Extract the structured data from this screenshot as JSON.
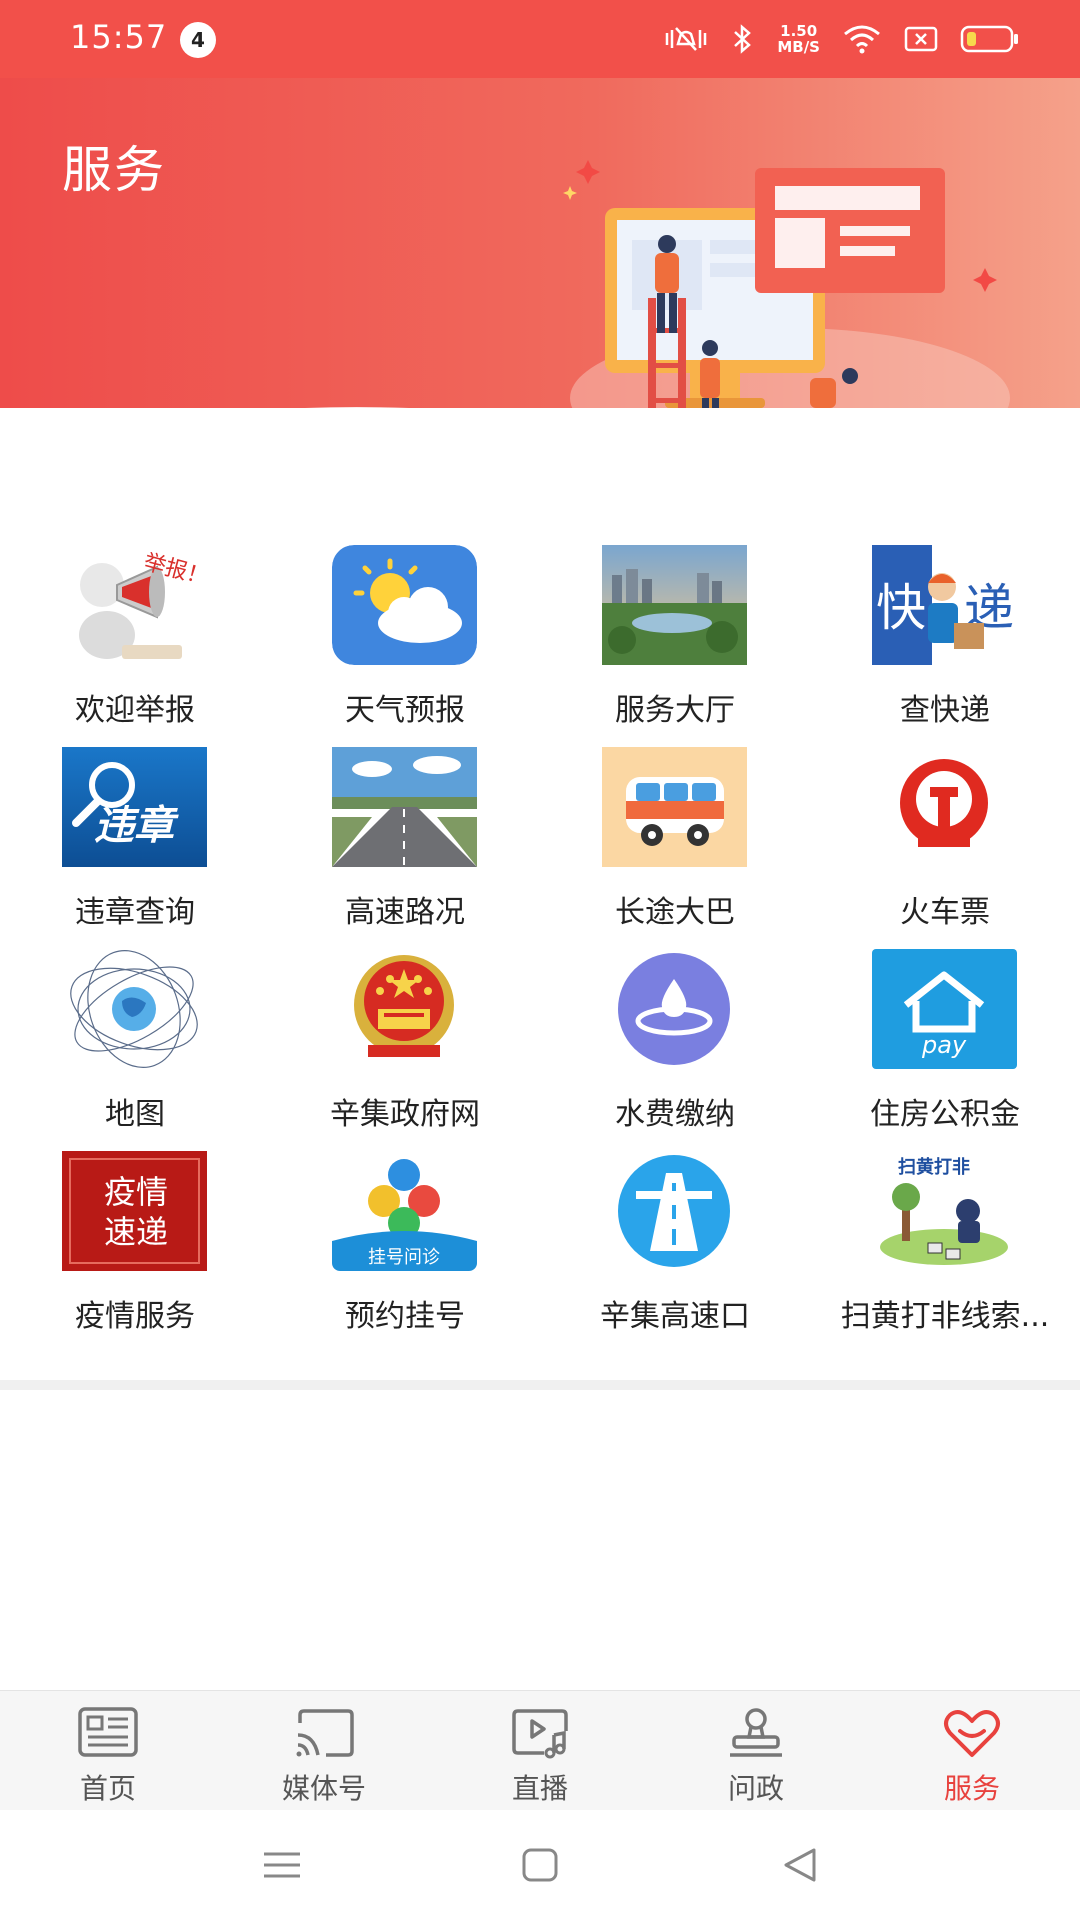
{
  "status_bar": {
    "time": "15:57",
    "notification_count": "4",
    "speed_value": "1.50",
    "speed_unit": "MB/S",
    "icons": [
      "mute-vibrate-icon",
      "bluetooth-icon",
      "wifi-icon",
      "sim-off-icon",
      "battery-low-icon"
    ]
  },
  "header": {
    "title": "服务",
    "background_colors": [
      "#ee4c4a",
      "#f5a18a"
    ]
  },
  "services": [
    {
      "label": "欢迎举报",
      "icon": "megaphone-report-icon"
    },
    {
      "label": "天气预报",
      "icon": "weather-sun-cloud-icon"
    },
    {
      "label": "服务大厅",
      "icon": "city-photo-icon"
    },
    {
      "label": "查快递",
      "icon": "express-courier-icon"
    },
    {
      "label": "违章查询",
      "icon": "violation-search-icon"
    },
    {
      "label": "高速路况",
      "icon": "highway-photo-icon"
    },
    {
      "label": "长途大巴",
      "icon": "bus-icon"
    },
    {
      "label": "火车票",
      "icon": "railway-logo-icon"
    },
    {
      "label": "地图",
      "icon": "globe-map-icon"
    },
    {
      "label": "辛集政府网",
      "icon": "national-emblem-icon"
    },
    {
      "label": "水费缴纳",
      "icon": "water-drop-icon"
    },
    {
      "label": "住房公积金",
      "icon": "house-pay-icon"
    },
    {
      "label": "疫情服务",
      "icon": "epidemic-news-icon"
    },
    {
      "label": "预约挂号",
      "icon": "hospital-appointment-icon"
    },
    {
      "label": "辛集高速口",
      "icon": "highway-road-icon"
    },
    {
      "label": "扫黄打非线索...",
      "icon": "anti-porn-illustration-icon"
    }
  ],
  "icon_texts": {
    "report_bubble": "举报！",
    "express_left": "快",
    "express_right": "递",
    "violation": "违章",
    "pay": "pay",
    "epidemic_line1": "疫情",
    "epidemic_line2": "速递",
    "hospital_caption": "挂号问诊",
    "anti_title": "扫黄打非"
  },
  "tabbar": {
    "tabs": [
      {
        "label": "首页",
        "icon": "newspaper-icon",
        "active": false
      },
      {
        "label": "媒体号",
        "icon": "cast-icon",
        "active": false
      },
      {
        "label": "直播",
        "icon": "live-video-icon",
        "active": false
      },
      {
        "label": "问政",
        "icon": "stamp-icon",
        "active": false
      },
      {
        "label": "服务",
        "icon": "heart-icon",
        "active": true
      }
    ],
    "active_color": "#e8423e"
  },
  "system_nav": {
    "buttons": [
      "menu-icon",
      "home-icon",
      "back-icon"
    ]
  }
}
